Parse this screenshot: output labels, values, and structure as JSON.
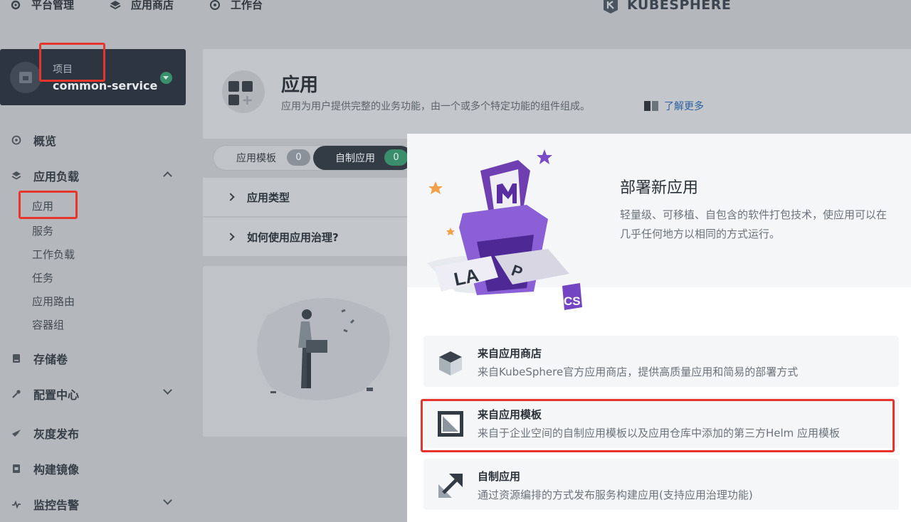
{
  "topbar": {
    "nav": [
      {
        "label": "平台管理",
        "icon": "gear-icon"
      },
      {
        "label": "应用商店",
        "icon": "cube-stack-icon"
      },
      {
        "label": "工作台",
        "icon": "dashboard-icon"
      }
    ],
    "logo_text": "KUBESPHERE"
  },
  "project": {
    "type_label": "项目",
    "name": "common-service"
  },
  "sidebar": {
    "items": [
      {
        "label": "概览",
        "icon": "overview-icon"
      },
      {
        "label": "应用负载",
        "icon": "layers-icon"
      },
      {
        "label": "存储卷",
        "icon": "storage-icon"
      },
      {
        "label": "配置中心",
        "icon": "wrench-icon"
      },
      {
        "label": "灰度发布",
        "icon": "bird-icon"
      },
      {
        "label": "构建镜像",
        "icon": "image-build-icon"
      },
      {
        "label": "监控告警",
        "icon": "monitor-icon"
      }
    ],
    "workload_sub": [
      "应用",
      "服务",
      "工作负载",
      "任务",
      "应用路由",
      "容器组"
    ]
  },
  "header": {
    "title": "应用",
    "description": "应用为用户提供完整的业务功能，由一个或多个特定功能的组件组成。",
    "learn_more": "了解更多"
  },
  "tabs": [
    {
      "label": "应用模板",
      "count": "0"
    },
    {
      "label": "自制应用",
      "count": "0"
    }
  ],
  "collapses": [
    {
      "label": "应用类型"
    },
    {
      "label": "如何使用应用治理?"
    }
  ],
  "modal": {
    "title": "部署新应用",
    "description": "轻量级、可移植、自包含的软件打包技术，使应用可以在几乎任何地方以相同的方式运行。",
    "options": [
      {
        "title": "来自应用商店",
        "desc": "来自KubeSphere官方应用商店，提供高质量应用和简易的部署方式",
        "icon": "cube-icon"
      },
      {
        "title": "来自应用模板",
        "desc": "来自于企业空间的自制应用模板以及应用仓库中添加的第三方Helm 应用模板",
        "icon": "template-icon"
      },
      {
        "title": "自制应用",
        "desc": "通过资源编排的方式发布服务构建应用(支持应用治理功能)",
        "icon": "expand-arrow-icon"
      }
    ],
    "hero_letters": "LAMP",
    "hero_badge": "CS"
  },
  "colors": {
    "annotation_red": "#e8352b",
    "accent_green": "#3b8e6c",
    "link_blue": "#2c5f9e",
    "modal_bg": "#ffffff",
    "overlay": "#b4b8bd"
  }
}
